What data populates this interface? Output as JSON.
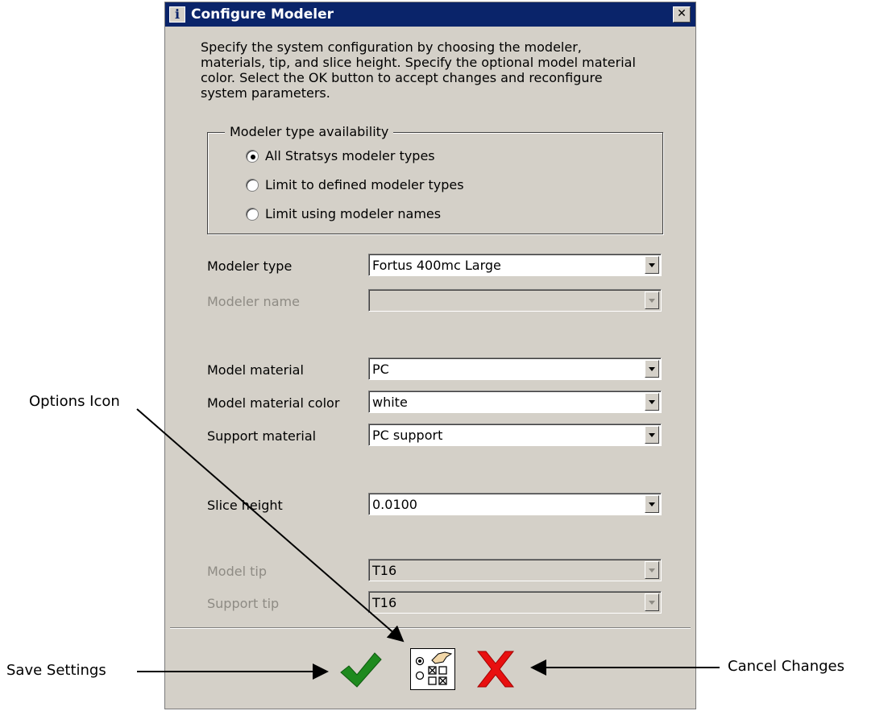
{
  "dialog": {
    "title": "Configure Modeler",
    "title_icon": "info-icon",
    "close_glyph": "✕",
    "description": "Specify the system configuration by choosing the modeler, materials, tip, and slice height. Specify the optional model material color. Select the OK button to accept changes and reconfigure system parameters.",
    "availability_group": {
      "legend": "Modeler type availability",
      "options": [
        {
          "label": "All Stratsys modeler types",
          "selected": true
        },
        {
          "label": "Limit to defined modeler types",
          "selected": false
        },
        {
          "label": "Limit using modeler names",
          "selected": false
        }
      ]
    },
    "fields": {
      "modeler_type": {
        "label": "Modeler type",
        "value": "Fortus 400mc Large",
        "enabled": true
      },
      "modeler_name": {
        "label": "Modeler name",
        "value": "",
        "enabled": false
      },
      "model_material": {
        "label": "Model material",
        "value": "PC",
        "enabled": true
      },
      "model_material_color": {
        "label": "Model material color",
        "value": "white",
        "enabled": true
      },
      "support_material": {
        "label": "Support material",
        "value": "PC support",
        "enabled": true
      },
      "slice_height": {
        "label": "Slice height",
        "value": "0.0100",
        "enabled": true
      },
      "model_tip": {
        "label": "Model tip",
        "value": "T16",
        "enabled": false
      },
      "support_tip": {
        "label": "Support tip",
        "value": "T16",
        "enabled": false
      }
    },
    "actions": {
      "save_icon": "checkmark-icon",
      "options_icon": "options-icon",
      "cancel_icon": "x-icon"
    }
  },
  "callouts": {
    "options": "Options Icon",
    "save": "Save Settings",
    "cancel": "Cancel Changes"
  },
  "colors": {
    "titlebar": "#0a246a",
    "dialog_bg": "#d4d0c8",
    "save_green": "#1e8a1e",
    "cancel_red": "#e81010"
  }
}
